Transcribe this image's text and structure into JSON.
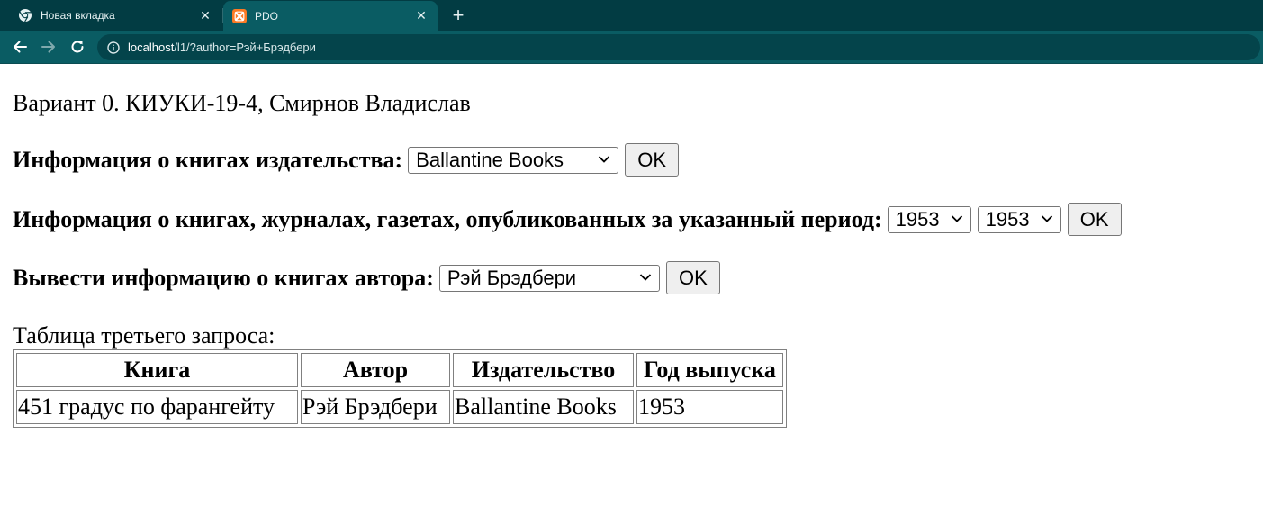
{
  "browser": {
    "tabs": [
      {
        "title": "Новая вкладка",
        "icon": "chrome-icon",
        "active": false
      },
      {
        "title": "PDO",
        "icon": "xampp-icon",
        "active": true
      }
    ],
    "url": {
      "host": "localhost",
      "path": "/l1/?author=Рэй+Брэдбери"
    }
  },
  "page": {
    "variant_text": "Вариант 0. КИУКИ-19-4, Смирнов Владислав",
    "publisher_form": {
      "label": "Информация о книгах издательства:",
      "selected": "Ballantine Books",
      "button": "OK"
    },
    "period_form": {
      "label": "Информация о книгах, журналах, газетах, опубликованных за указанный период:",
      "from_selected": "1953",
      "to_selected": "1953",
      "button": "OK"
    },
    "author_form": {
      "label": "Вывести информацию о книгах автора:",
      "selected": "Рэй Брэдбери",
      "button": "OK"
    },
    "table_caption": "Таблица третьего запроса:",
    "table": {
      "headers": [
        "Книга",
        "Автор",
        "Издательство",
        "Год выпуска"
      ],
      "rows": [
        [
          "451 градус по фарангейту",
          "Рэй Брэдбери",
          "Ballantine Books",
          "1953"
        ]
      ]
    }
  },
  "colors": {
    "tabbar_bg": "#023c43",
    "toolbar_bg": "#0a5c63",
    "xampp_orange": "#fb7a24"
  }
}
